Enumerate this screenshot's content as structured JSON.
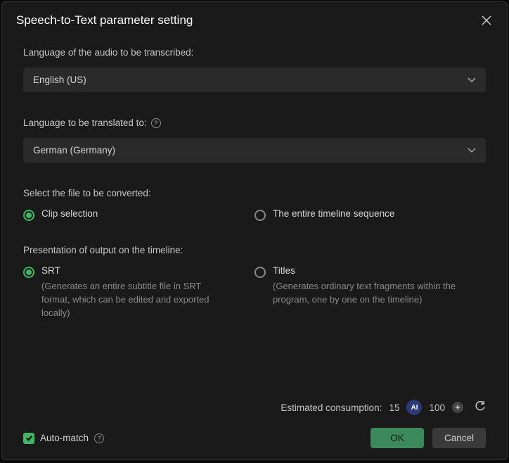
{
  "title": "Speech-to-Text parameter setting",
  "source_lang": {
    "label": "Language of the audio to be transcribed:",
    "value": "English (US)"
  },
  "target_lang": {
    "label": "Language to be translated to:",
    "value": "German (Germany)"
  },
  "file_select": {
    "label": "Select the file to be converted:",
    "options": {
      "clip": "Clip selection",
      "timeline": "The entire timeline sequence"
    },
    "selected": "clip"
  },
  "presentation": {
    "label": "Presentation of output on the timeline:",
    "options": {
      "srt": {
        "label": "SRT",
        "desc": "(Generates an entire subtitle file in SRT format, which can be edited and exported locally)"
      },
      "titles": {
        "label": "Titles",
        "desc": "(Generates ordinary text fragments within the program, one by one on the timeline)"
      }
    },
    "selected": "srt"
  },
  "consumption": {
    "label": "Estimated consumption:",
    "value": "15",
    "credits": "100"
  },
  "auto_match": {
    "label": "Auto-match",
    "checked": true
  },
  "buttons": {
    "ok": "OK",
    "cancel": "Cancel"
  }
}
